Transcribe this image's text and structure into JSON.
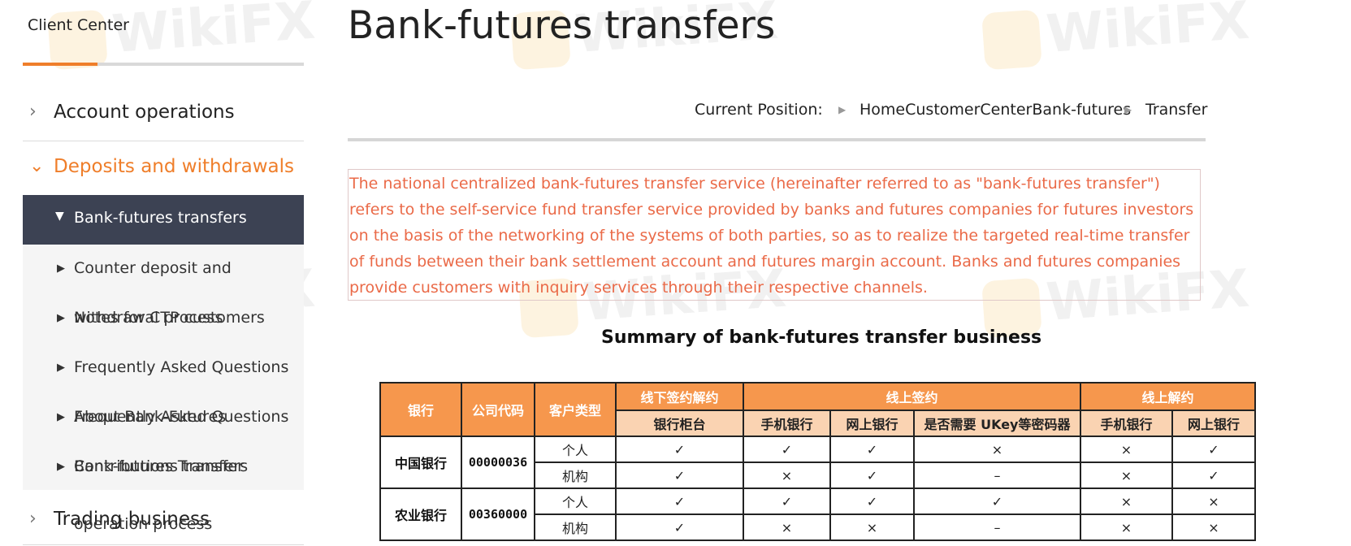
{
  "sidebar": {
    "title": "Client Center",
    "categories": [
      {
        "label": "Account operations",
        "expanded": false
      },
      {
        "label": "Deposits and withdrawals",
        "expanded": true
      },
      {
        "label": "Trading business",
        "expanded": false
      }
    ],
    "items": [
      {
        "label": "Bank-futures transfers",
        "active": true
      },
      {
        "label": "Counter deposit and",
        "overlap": ""
      },
      {
        "label": "withdrawal process",
        "overlap": "Notes for CTP customers"
      },
      {
        "label": "Frequently Asked Questions",
        "overlap": ""
      },
      {
        "label": "Frequently Asked Questions",
        "overlap": "About Bank-Futures"
      },
      {
        "label": "Bank-futures Transfers",
        "overlap": "Contributions transfer"
      }
    ],
    "wrap_text": "operation process"
  },
  "main": {
    "title": "Bank-futures transfers",
    "breadcrumb": {
      "label": "Current Position:",
      "path": "HomeCustomerCenterBank-futures",
      "current": "Transfer"
    },
    "intro": "The national centralized bank-futures transfer service (hereinafter referred to as \"bank-futures transfer\") refers to the self-service fund transfer service provided by banks and futures companies for futures investors on the basis of the networking of the systems of both parties, so as to realize the targeted real-time transfer of funds between their bank settlement account and futures margin account. Banks and futures companies provide customers with inquiry services through their respective channels.",
    "summary_title": "Summary of bank-futures transfer business"
  },
  "table": {
    "headers": {
      "bank": "银行",
      "code": "公司代码",
      "type": "客户类型",
      "offline": "线下签约解约",
      "online_sign": "线上签约",
      "online_cancel": "线上解约"
    },
    "subheaders": {
      "counter": "银行柜台",
      "mobile": "手机银行",
      "web": "网上银行",
      "ukey": "是否需要 UKey等密码器",
      "mobile2": "手机银行",
      "web2": "网上银行"
    },
    "rows": [
      {
        "bank": "中国银行",
        "code": "00000036",
        "type": "个人",
        "cells": [
          "✓",
          "✓",
          "✓",
          "×",
          "×",
          "✓"
        ]
      },
      {
        "type": "机构",
        "cells": [
          "✓",
          "×",
          "✓",
          "–",
          "×",
          "✓"
        ]
      },
      {
        "bank": "农业银行",
        "code": "00360000",
        "type": "个人",
        "cells": [
          "✓",
          "✓",
          "✓",
          "✓",
          "×",
          "×"
        ]
      },
      {
        "type": "机构",
        "cells": [
          "✓",
          "×",
          "×",
          "–",
          "×",
          "×"
        ]
      }
    ]
  },
  "watermark": "WikiFX",
  "colors": {
    "accent": "#ef7e2a",
    "active_bg": "#3c4253",
    "intro_text": "#ea6a48",
    "table_header": "#f6974d",
    "table_subheader": "#fad3b2"
  },
  "icons": {
    "collapsed": "chevron-right-icon",
    "expanded": "chevron-down-icon",
    "bullet": "caret-right-icon",
    "bullet_active": "caret-down-icon"
  }
}
